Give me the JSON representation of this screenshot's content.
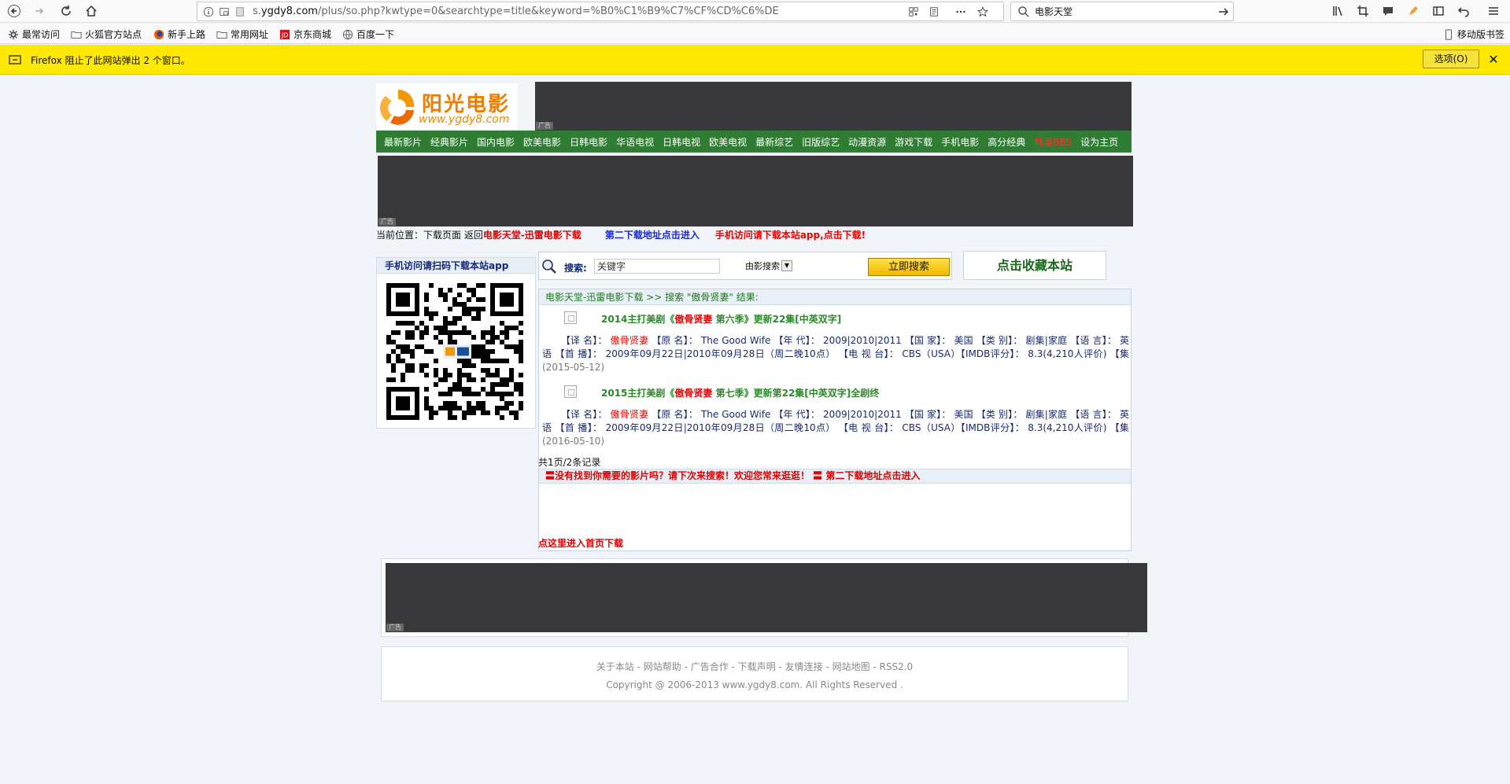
{
  "browser": {
    "url_prefix": "s.",
    "url_host": "ygdy8.com",
    "url_path": "/plus/so.php?kwtype=0&searchtype=title&keyword=%B0%C1%B9%C7%CF%CD%C6%DE",
    "search_value": "电影天堂",
    "bookmarks": [
      "最常访问",
      "火狐官方站点",
      "新手上路",
      "常用网址",
      "京东商城",
      "百度一下"
    ],
    "mobile_bookmarks": "移动版书签",
    "notice_text": "Firefox 阻止了此网站弹出 2 个窗口。",
    "options_label": "选项(O)",
    "close_label": "✕"
  },
  "site": {
    "logo_title": "阳光电影",
    "logo_url": "www.ygdy8.com",
    "ad_tag": "广告",
    "nav": [
      "最新影片",
      "经典影片",
      "国内电影",
      "欧美电影",
      "日韩电影",
      "华语电视",
      "日韩电视",
      "欧美电视",
      "最新综艺",
      "旧版综艺",
      "动漫资源",
      "游戏下载",
      "手机电影",
      "高分经典",
      "韩漫BBS",
      "设为主页"
    ]
  },
  "crumb": {
    "prefix": "当前位置：下载页面 返回",
    "home_link": "电影天堂-迅雷电影下载",
    "second_link": "第二下载地址点击进入",
    "app_link": "手机访问请下载本站app,点击下载!"
  },
  "sidebar": {
    "header": "手机访问请扫码下载本站app"
  },
  "search": {
    "label": "搜索:",
    "value": "关键字",
    "select_value": "由影搜索",
    "button": "立即搜索",
    "favorite": "点击收藏本站"
  },
  "results": {
    "header": "电影天堂-迅雷电影下载 >> 搜索 \"傲骨贤妻\" 结果:",
    "items": [
      {
        "title_pre": "2014主打美剧《",
        "title_kw": "傲骨贤妻",
        "title_post": " 第六季》更新22集[中英双字]",
        "desc_pre": "【译 名】：",
        "desc_kw": "傲骨贤妻",
        "desc_body": "【原 名】： The Good Wife 【年 代】： 2009|2010|2011 【国 家】： 美国 【类 别】： 剧集|家庭 【语 言】： 英语 【首 播】： 2009年09月22日|2010年09月28日（周二晚10点） 【电 视 台】： CBS（USA）【IMDB评分】： 8.3(4,210人评价) 【集",
        "date": "(2015-05-12)"
      },
      {
        "title_pre": "2015主打美剧《",
        "title_kw": "傲骨贤妻",
        "title_post": " 第七季》更新第22集[中英双字]全剧终",
        "desc_pre": "【译 名】：",
        "desc_kw": "傲骨贤妻",
        "desc_body": "【原 名】： The Good Wife 【年 代】： 2009|2010|2011 【国 家】： 美国 【类 别】： 剧集|家庭 【语 言】： 英语 【首 播】： 2009年09月22日|2010年09月28日（周二晚10点） 【电 视 台】： CBS（USA）【IMDB评分】： 8.3(4,210人评价) 【集",
        "date": "(2016-05-10)"
      }
    ],
    "pager": "共1页/2条记录",
    "not_found": "〓没有找到你需要的影片吗？请下次来搜索！欢迎您常来逛逛！ 〓 第二下载地址点击进入",
    "home_link": "点这里进入首页下载"
  },
  "footer": {
    "links": "关于本站 - 网站帮助 - 广告合作 - 下载声明 - 友情连接 - 网站地图 - RSS2.0",
    "copyright": "Copyright @ 2006-2013 www.ygdy8.com. All Rights Reserved ."
  }
}
